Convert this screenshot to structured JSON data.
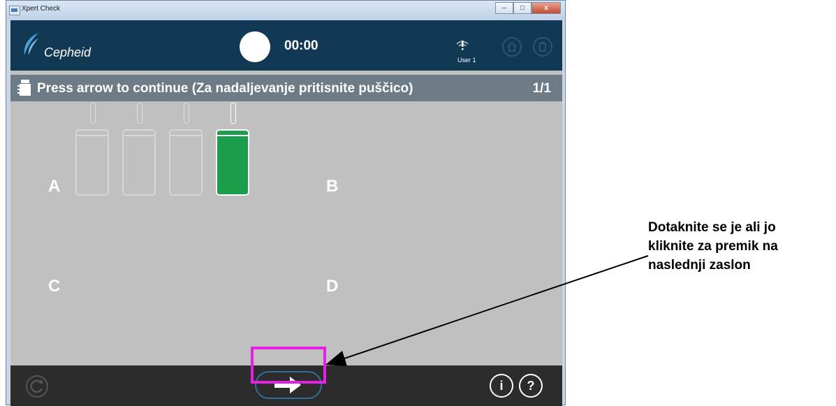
{
  "window": {
    "title": "Xpert Check",
    "controls": {
      "minimize": "–",
      "maximize": "□",
      "close": "x"
    }
  },
  "header": {
    "logo_text": "Cepheid",
    "timer": "00:00",
    "user": "User 1",
    "status_icon": "wifi-alert-icon",
    "nav_icons": [
      "home-icon",
      "cartridge-icon"
    ]
  },
  "status_bar": {
    "icon": "cartridge-icon",
    "instruction": "Press arrow to continue (Za nadaljevanje pritisnite puščico)",
    "page": "1/1"
  },
  "quadrants": {
    "A": "A",
    "B": "B",
    "C": "C",
    "D": "D",
    "quadrant_a_modules": [
      {
        "state": "empty"
      },
      {
        "state": "empty"
      },
      {
        "state": "empty"
      },
      {
        "state": "selected"
      }
    ]
  },
  "footer": {
    "refresh_icon": "refresh-icon",
    "next_icon": "arrow-right-icon",
    "info_label": "i",
    "help_label": "?"
  },
  "annotation": {
    "callout_lines": [
      "Dotaknite se je ali jo",
      "kliknite za premik na",
      "naslednji zaslon"
    ]
  },
  "colors": {
    "header_bg": "#123954",
    "status_bar_bg": "#6d7b86",
    "content_bg": "#c0c0c0",
    "footer_bg": "#2c2c2c",
    "selected_module": "#1b9e4b",
    "highlight": "#e61ee6"
  }
}
